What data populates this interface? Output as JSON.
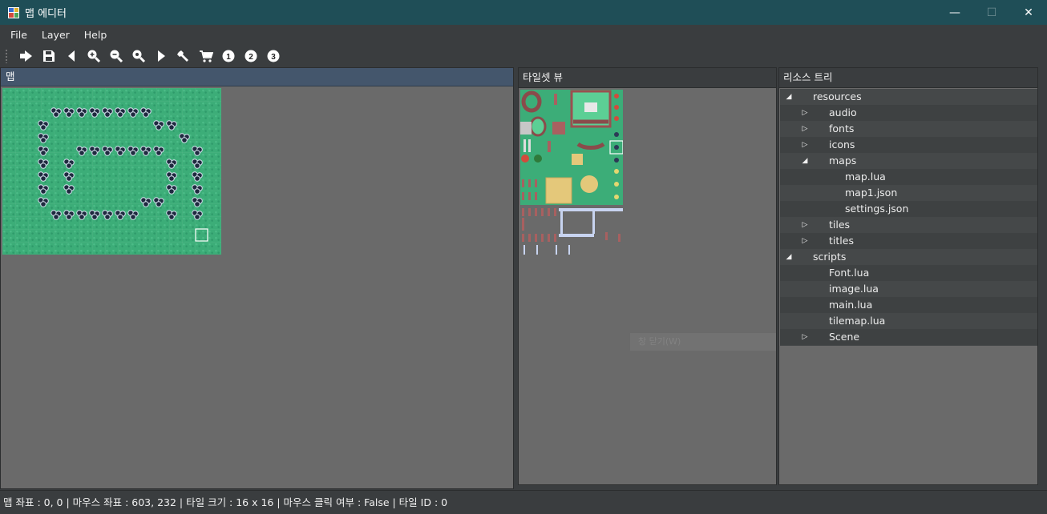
{
  "window": {
    "title": "맵 에디터",
    "controls": {
      "minimize": "—",
      "maximize": "☐",
      "close": "✕"
    }
  },
  "menu": [
    "File",
    "Layer",
    "Help"
  ],
  "toolbar": [
    {
      "name": "load-arrow-icon"
    },
    {
      "name": "save-icon"
    },
    {
      "name": "back-icon"
    },
    {
      "name": "zoom-in-icon"
    },
    {
      "name": "zoom-out-icon"
    },
    {
      "name": "zoom-reset-icon"
    },
    {
      "name": "play-icon"
    },
    {
      "name": "wrench-icon"
    },
    {
      "name": "cart-icon"
    },
    {
      "name": "layer-1-icon",
      "text": "1"
    },
    {
      "name": "layer-2-icon",
      "text": "2"
    },
    {
      "name": "layer-3-icon",
      "text": "3"
    }
  ],
  "map_panel": {
    "title": "맵"
  },
  "tileset_panel": {
    "title": "타일셋 뷰",
    "ghost_text": "창 닫기(W)"
  },
  "tree_panel": {
    "title": "리소스 트리",
    "items": [
      {
        "label": "resources",
        "level": 0,
        "toggle": "open"
      },
      {
        "label": "audio",
        "level": 1,
        "toggle": "closed"
      },
      {
        "label": "fonts",
        "level": 1,
        "toggle": "closed"
      },
      {
        "label": "icons",
        "level": 1,
        "toggle": "closed"
      },
      {
        "label": "maps",
        "level": 1,
        "toggle": "open"
      },
      {
        "label": "map.lua",
        "level": 2,
        "toggle": "none"
      },
      {
        "label": "map1.json",
        "level": 2,
        "toggle": "none"
      },
      {
        "label": "settings.json",
        "level": 2,
        "toggle": "none"
      },
      {
        "label": "tiles",
        "level": 1,
        "toggle": "closed"
      },
      {
        "label": "titles",
        "level": 1,
        "toggle": "closed"
      },
      {
        "label": "scripts",
        "level": 0,
        "toggle": "open"
      },
      {
        "label": "Font.lua",
        "level": 1,
        "toggle": "none"
      },
      {
        "label": "image.lua",
        "level": 1,
        "toggle": "none"
      },
      {
        "label": "main.lua",
        "level": 1,
        "toggle": "none"
      },
      {
        "label": "tilemap.lua",
        "level": 1,
        "toggle": "none"
      },
      {
        "label": "Scene",
        "level": 1,
        "toggle": "closed"
      }
    ]
  },
  "status": {
    "text": "맵 좌표 : 0, 0 | 마우스 좌표 : 603, 232 | 타일 크기 : 16 x 16 | 마우스 클릭 여부 : False | 타일 ID : 0"
  }
}
